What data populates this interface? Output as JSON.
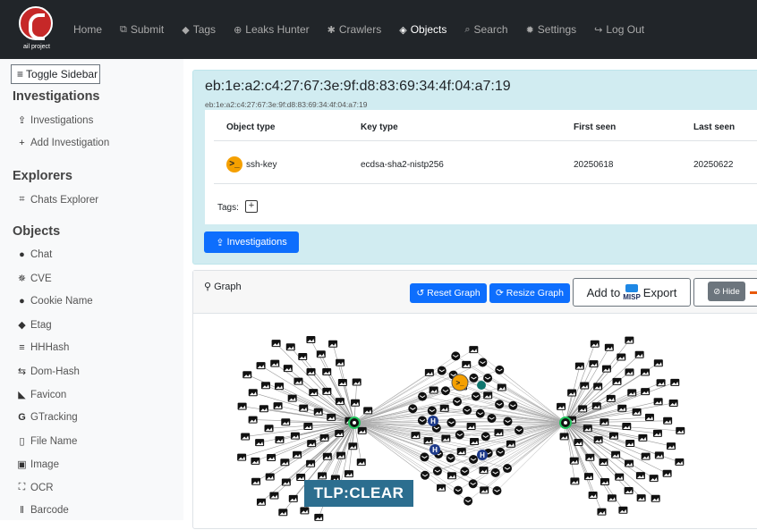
{
  "brand": {
    "logo_text": "ail project"
  },
  "nav": [
    {
      "label": "Home",
      "icon": "none"
    },
    {
      "label": "Submit",
      "icon": "external-link-icon"
    },
    {
      "label": "Tags",
      "icon": "tag-icon"
    },
    {
      "label": "Leaks Hunter",
      "icon": "crosshair-icon"
    },
    {
      "label": "Crawlers",
      "icon": "spider-icon"
    },
    {
      "label": "Objects",
      "icon": "cube-icon",
      "active": true
    },
    {
      "label": "Search",
      "icon": "search-icon"
    },
    {
      "label": "Settings",
      "icon": "cog-icon"
    },
    {
      "label": "Log Out",
      "icon": "sign-out-icon"
    }
  ],
  "sidebar": {
    "toggle_label": "Toggle Sidebar",
    "sections": [
      {
        "title": "Investigations",
        "items": [
          {
            "label": "Investigations",
            "icon": "upload-icon"
          },
          {
            "label": "Add Investigation",
            "icon": "plus-icon"
          }
        ]
      },
      {
        "title": "Explorers",
        "items": [
          {
            "label": "Chats Explorer",
            "icon": "comments-icon"
          }
        ]
      },
      {
        "title": "Objects",
        "items": [
          {
            "label": "Chat",
            "icon": "comments-icon"
          },
          {
            "label": "CVE",
            "icon": "bug-icon"
          },
          {
            "label": "Cookie Name",
            "icon": "cookie-icon"
          },
          {
            "label": "Etag",
            "icon": "tag-icon"
          },
          {
            "label": "HHHash",
            "icon": "align-left-icon"
          },
          {
            "label": "Dom-Hash",
            "icon": "map-signs-icon"
          },
          {
            "label": "Favicon",
            "icon": "bookmark-icon"
          },
          {
            "label": "GTracking",
            "icon": "google-icon"
          },
          {
            "label": "File Name",
            "icon": "file-icon"
          },
          {
            "label": "Image",
            "icon": "image-icon"
          },
          {
            "label": "OCR",
            "icon": "expand-icon"
          },
          {
            "label": "Barcode",
            "icon": "barcode-icon"
          }
        ]
      }
    ]
  },
  "object": {
    "title": "eb:1e:a2:c4:27:67:3e:9f:d8:83:69:34:4f:04:a7:19",
    "subtitle": "eb:1e:a2:c4:27:67:3e:9f:d8:83:69:34:4f:04:a7:19",
    "columns": [
      "Object type",
      "Key type",
      "First seen",
      "Last seen"
    ],
    "row": {
      "object_type": "ssh-key",
      "key_type": "ecdsa-sha2-nistp256",
      "first_seen": "20250618",
      "last_seen": "20250622"
    },
    "tags_label": "Tags:",
    "investigations_button": "Investigations"
  },
  "graph_panel": {
    "title": "Graph",
    "reset_button": "Reset Graph",
    "resize_button": "Resize Graph",
    "add_to_label": "Add to",
    "misp_label": "MISP",
    "export_label": "Export",
    "hide_label": "Hide",
    "tlp_badge": "TLP:CLEAR"
  },
  "colors": {
    "nav_bg": "#212529",
    "primary": "#0d6efd",
    "info_bg": "#d1ecf1",
    "tlp_bg": "#2c6e8f",
    "ssh_icon": "#f5a000"
  }
}
